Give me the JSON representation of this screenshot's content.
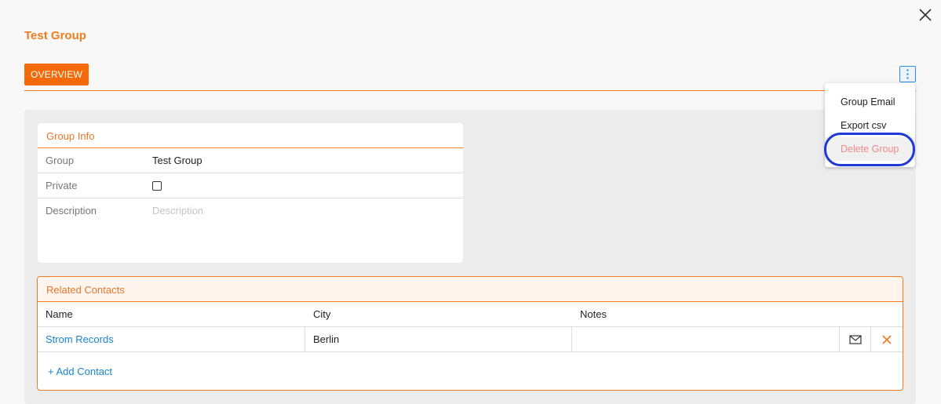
{
  "header": {
    "title": "Test Group"
  },
  "tabs": [
    {
      "label": "OVERVIEW"
    }
  ],
  "menu": {
    "items": [
      {
        "label": "Group Email"
      },
      {
        "label": "Export csv"
      },
      {
        "label": "Delete Group"
      }
    ]
  },
  "group_info": {
    "title": "Group Info",
    "rows": {
      "group": {
        "label": "Group",
        "value": "Test Group"
      },
      "private": {
        "label": "Private",
        "checked": false
      },
      "description": {
        "label": "Description",
        "placeholder": "Description",
        "value": ""
      }
    }
  },
  "related_contacts": {
    "title": "Related Contacts",
    "columns": [
      "Name",
      "City",
      "Notes"
    ],
    "rows": [
      {
        "name": "Strom Records",
        "city": "Berlin",
        "notes": ""
      }
    ],
    "add_label": "+ Add Contact"
  },
  "icons": {
    "close": "close-icon",
    "kebab": "kebab-menu-icon",
    "mail": "mail-icon",
    "remove": "remove-x-icon"
  },
  "colors": {
    "accent": "#f07c1e",
    "tab_bg": "#f46a09",
    "link": "#1a84d0",
    "danger_text": "#f08a8a",
    "focus_ring": "#1d39d6"
  }
}
